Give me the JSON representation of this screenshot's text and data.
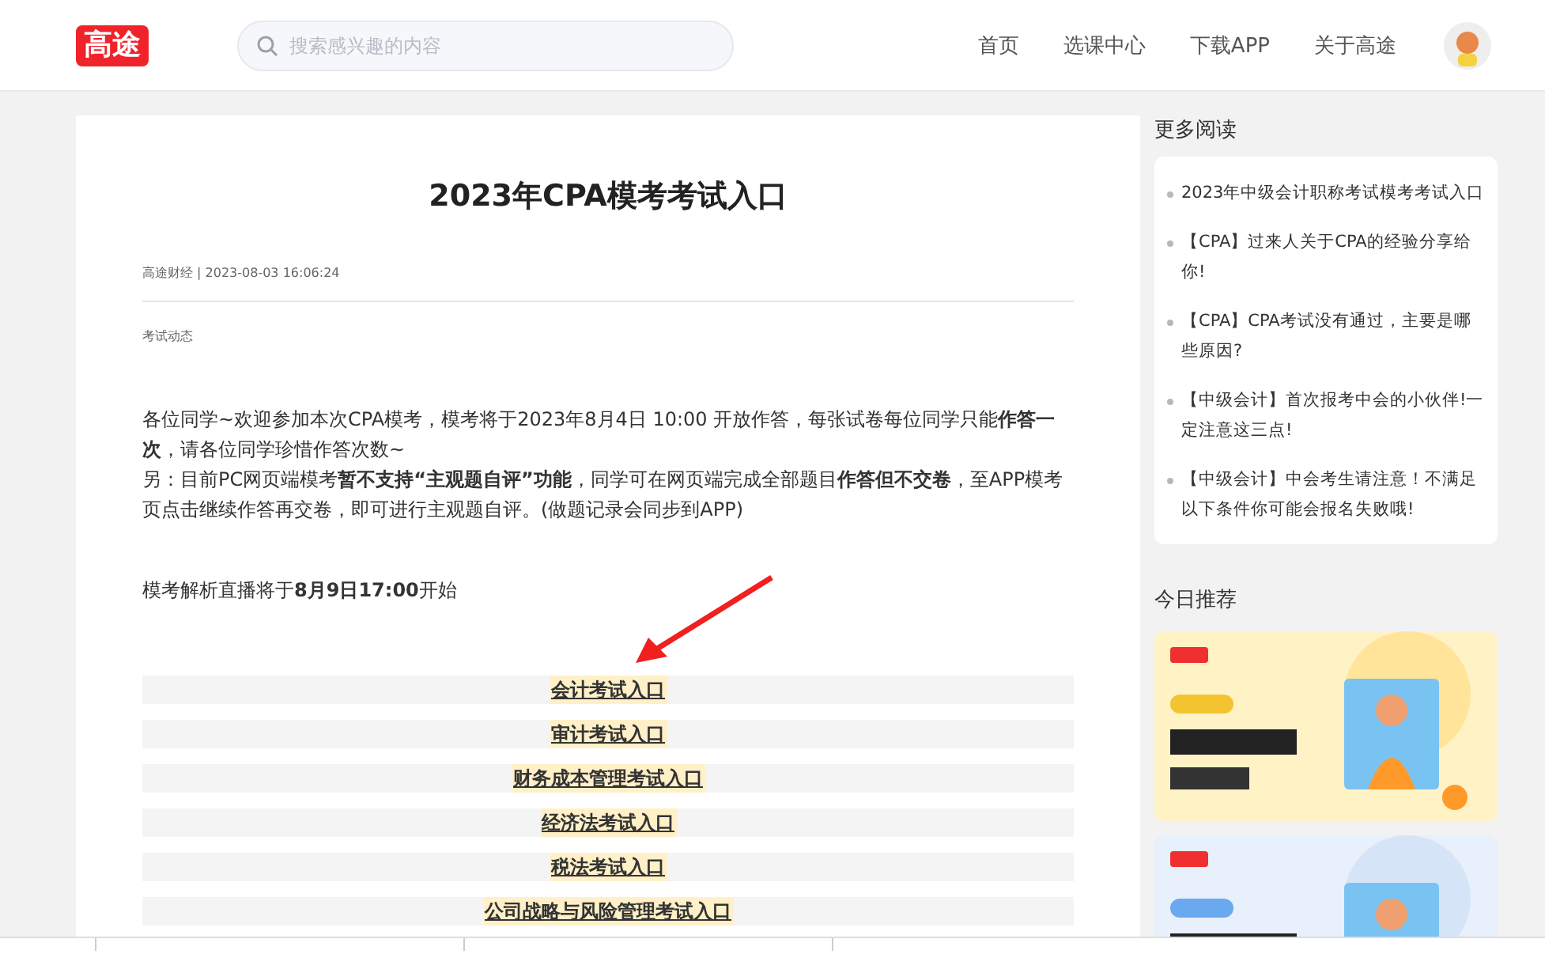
{
  "header": {
    "logo": "高途",
    "search": {
      "placeholder": "搜索感兴趣的内容"
    },
    "nav": [
      "首页",
      "选课中心",
      "下载APP",
      "关于高途"
    ]
  },
  "article": {
    "title": "2023年CPA模考考试入口",
    "meta": "高途财经 | 2023-08-03 16:06:24",
    "category": "考试动态",
    "paragraphs": [
      "各位同学~欢迎参加本次CPA模考，模考将于2023年8月4日 10:00 开放作答，每张试卷每位同学只能**作答一次**，请各位同学珍惜作答次数~",
      "另：目前PC网页端模考**暂不支持“主观题自评”功能**，同学可在网页端完成全部题目**作答但不交卷**，至APP模考页点击继续作答再交卷，即可进行主观题自评。(做题记录会同步到APP)"
    ],
    "notice": "模考解析直播将于**8月9日17:00**开始",
    "entries": [
      "会计考试入口",
      "审计考试入口",
      "财务成本管理考试入口",
      "经济法考试入口",
      "税法考试入口",
      "公司战略与风险管理考试入口"
    ]
  },
  "sidebar": {
    "more_title": "更多阅读",
    "more_items": [
      "2023年中级会计职称考试模考考试入口",
      "【CPA】过来人关于CPA的经验分享给你!",
      "【CPA】CPA考试没有通过，主要是哪些原因?",
      "【中级会计】首次报考中会的小伙伴!一定注意这三点!",
      "【中级会计】中会考生请注意！不满足以下条件你可能会报名失败哦!"
    ],
    "recommend_title": "今日推荐",
    "banners": [
      {
        "kind": "picture"
      },
      {
        "kind": "picture"
      }
    ]
  }
}
